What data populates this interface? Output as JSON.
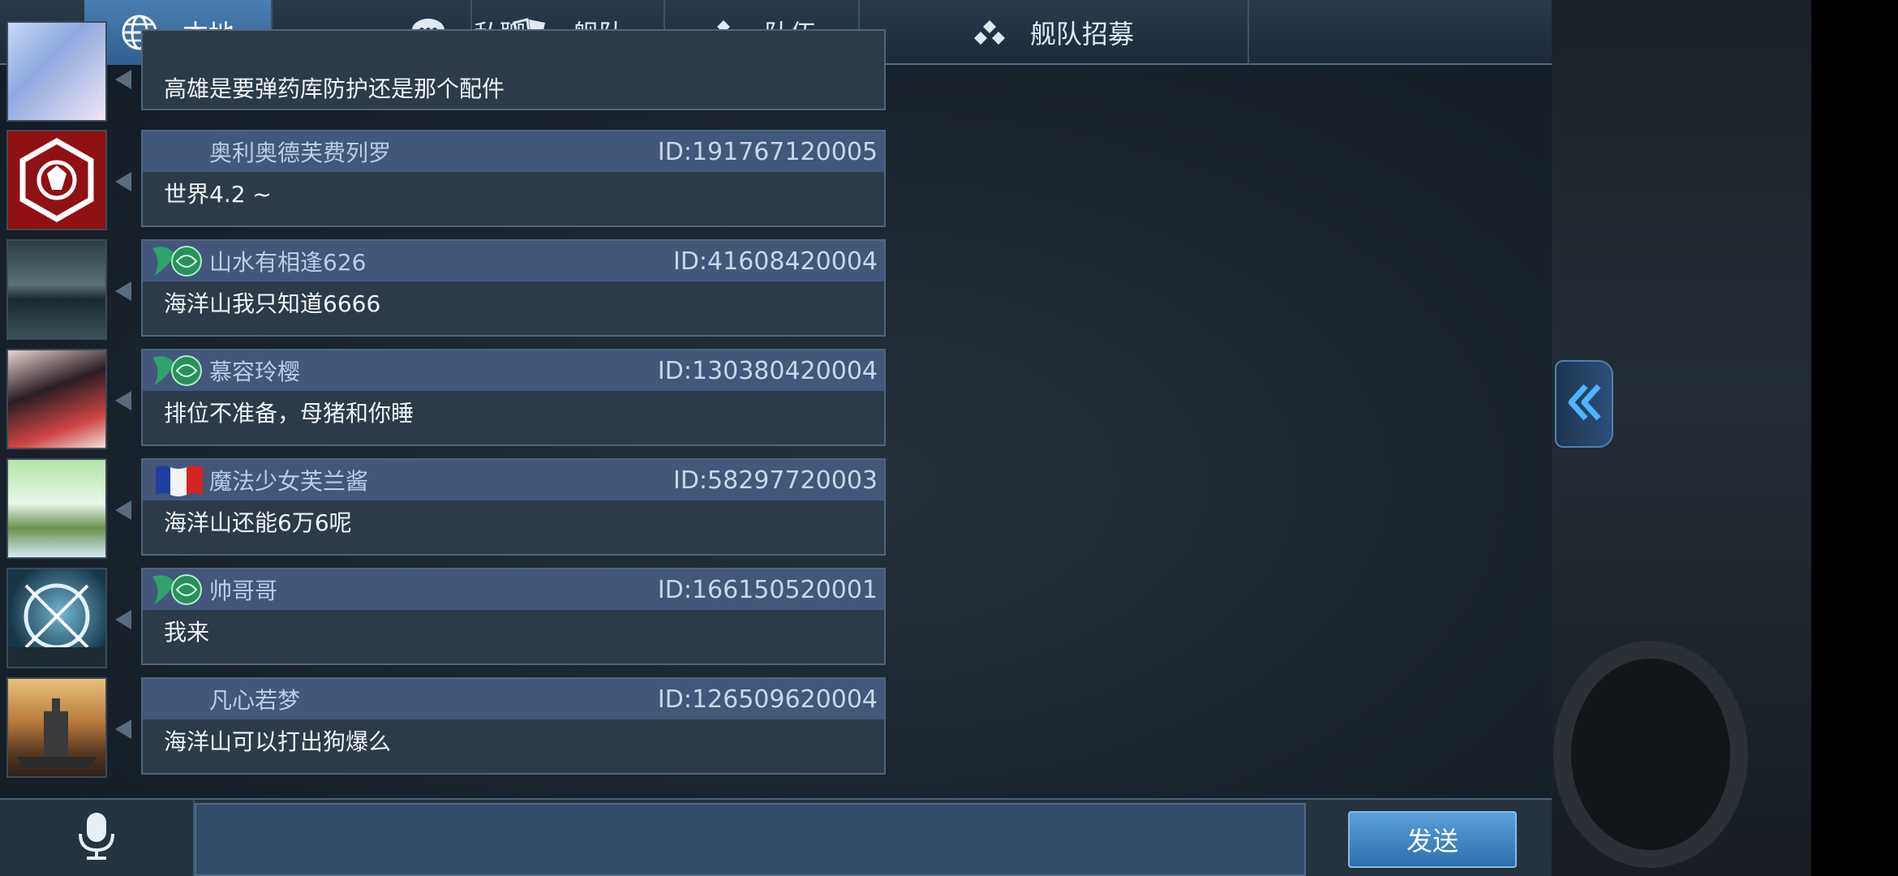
{
  "tabs": [
    {
      "label": "本地",
      "icon": "globe-icon",
      "active": true
    },
    {
      "label": "私聊",
      "icon": "chat-bubble-icon",
      "active": false
    },
    {
      "label": "舰队",
      "icon": "fleet-icon",
      "active": false
    },
    {
      "label": "队伍",
      "icon": "team-icon",
      "active": false
    },
    {
      "label": "舰队招募",
      "icon": "team-icon",
      "active": false
    }
  ],
  "partial_message": {
    "text": "高雄是要弹药库防护还是那个配件"
  },
  "messages": [
    {
      "name": "奥利奥德芙费列罗",
      "id": "ID:191767120005",
      "text": "世界4.2 ~",
      "badge": "none",
      "avatar": "red-emblem"
    },
    {
      "name": "山水有相逢626",
      "id": "ID:41608420004",
      "text": "海洋山我只知道6666",
      "badge": "green-wing",
      "avatar": "storm-sea"
    },
    {
      "name": "慕容玲樱",
      "id": "ID:130380420004",
      "text": "排位不准备，母猪和你睡",
      "badge": "green-wing",
      "avatar": "anime-girl"
    },
    {
      "name": "魔法少女芙兰酱",
      "id": "ID:58297720003",
      "text": "海洋山还能6万6呢",
      "badge": "french-flag",
      "avatar": "leaf-girl"
    },
    {
      "name": "帅哥哥",
      "id": "ID:166150520001",
      "text": "我来",
      "badge": "green-wing",
      "avatar": "crosshair"
    },
    {
      "name": "凡心若梦",
      "id": "ID:126509620004",
      "text": "海洋山可以打出狗爆么",
      "badge": "none",
      "avatar": "battleship"
    }
  ],
  "input": {
    "value": "",
    "placeholder": ""
  },
  "send_label": "发送",
  "colors": {
    "accent": "#4a7fb3",
    "bubble_head": "#42577a",
    "badge_green": "#2fa36b"
  }
}
